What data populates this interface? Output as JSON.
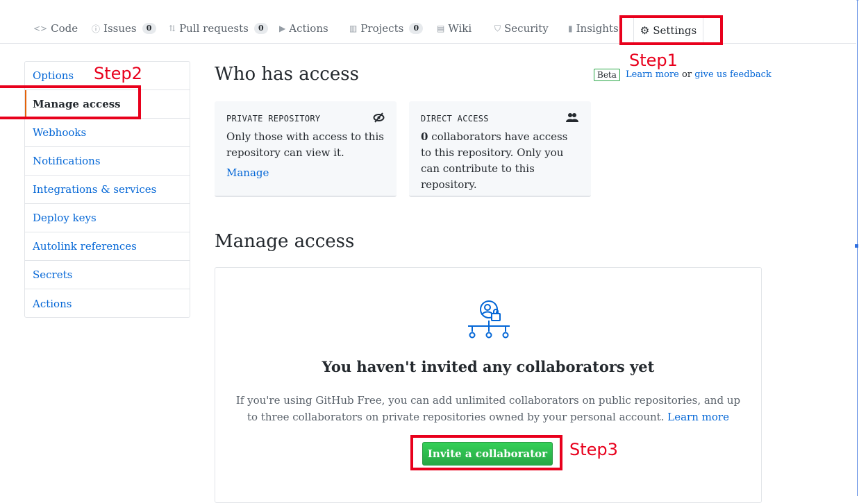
{
  "tabs": [
    {
      "name": "code",
      "icon": "code-icon",
      "label": "Code",
      "count": ""
    },
    {
      "name": "issues",
      "icon": "issue-icon",
      "label": "Issues",
      "count": "0"
    },
    {
      "name": "pull-requests",
      "icon": "pull-request-icon",
      "label": "Pull requests",
      "count": "0"
    },
    {
      "name": "actions",
      "icon": "play-icon",
      "label": "Actions",
      "count": ""
    },
    {
      "name": "projects",
      "icon": "project-icon",
      "label": "Projects",
      "count": "0"
    },
    {
      "name": "wiki",
      "icon": "book-icon",
      "label": "Wiki",
      "count": ""
    },
    {
      "name": "security",
      "icon": "shield-icon",
      "label": "Security",
      "count": ""
    },
    {
      "name": "insights",
      "icon": "graph-icon",
      "label": "Insights",
      "count": ""
    },
    {
      "name": "settings",
      "icon": "gear-icon",
      "label": "Settings",
      "count": ""
    }
  ],
  "steps": {
    "step1": "Step1",
    "step2": "Step2",
    "step3": "Step3"
  },
  "sidebar": {
    "items": [
      "Options",
      "Manage access",
      "Webhooks",
      "Notifications",
      "Integrations & services",
      "Deploy keys",
      "Autolink references",
      "Secrets",
      "Actions"
    ],
    "selected": "Manage access"
  },
  "who_has_access": {
    "heading": "Who has access",
    "beta_label": "Beta",
    "learn_more": "Learn more",
    "or_text": "or",
    "feedback": "give us feedback",
    "private_card": {
      "title": "PRIVATE REPOSITORY",
      "icon": "eye-closed-icon",
      "body": "Only those with access to this repository can view it.",
      "link": "Manage"
    },
    "direct_card": {
      "title": "DIRECT ACCESS",
      "icon": "people-icon",
      "count": "0",
      "body": "collaborators have access to this repository. Only you can contribute to this repository."
    }
  },
  "manage_access": {
    "heading": "Manage access",
    "icon": "collaborators-lock-icon",
    "blank_title": "You haven't invited any collaborators yet",
    "blank_text": "If you're using GitHub Free, you can add unlimited collaborators on public repositories, and up to three collaborators on private repositories owned by your personal account.",
    "learn_more": "Learn more",
    "invite_button": "Invite a collaborator"
  },
  "colors": {
    "accent_orange": "#e36209",
    "link_blue": "#0366d6",
    "button_green": "#28a745",
    "annotation_red": "#e8001c"
  }
}
